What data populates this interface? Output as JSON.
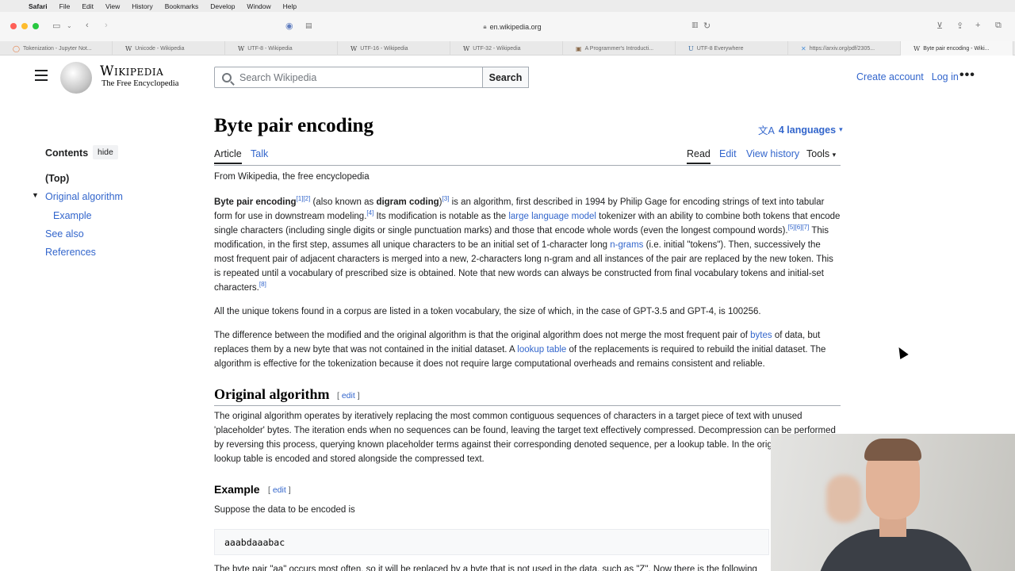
{
  "os_menu": {
    "apple": "",
    "items": [
      "Safari",
      "File",
      "Edit",
      "View",
      "History",
      "Bookmarks",
      "Develop",
      "Window",
      "Help"
    ]
  },
  "browser": {
    "url": "en.wikipedia.org",
    "tabs": [
      {
        "label": "Tokenization - Jupyter Not...",
        "favicon": "◯",
        "active": false
      },
      {
        "label": "Unicode - Wikipedia",
        "favicon": "W",
        "active": false
      },
      {
        "label": "UTF-8 - Wikipedia",
        "favicon": "W",
        "active": false
      },
      {
        "label": "UTF-16 - Wikipedia",
        "favicon": "W",
        "active": false
      },
      {
        "label": "UTF-32 - Wikipedia",
        "favicon": "W",
        "active": false
      },
      {
        "label": "A Programmer's Introducti...",
        "favicon": "▣",
        "active": false
      },
      {
        "label": "UTF-8 Everywhere",
        "favicon": "U",
        "active": false
      },
      {
        "label": "https://arxiv.org/pdf/2305...",
        "favicon": "✕",
        "active": false
      },
      {
        "label": "Byte pair encoding - Wiki...",
        "favicon": "W",
        "active": true
      }
    ]
  },
  "header": {
    "wordmark": "Wikipedia",
    "tagline": "The Free Encyclopedia",
    "search_placeholder": "Search Wikipedia",
    "search_button": "Search",
    "create_account": "Create account",
    "log_in": "Log in",
    "more": "•••"
  },
  "toc": {
    "title": "Contents",
    "hide": "hide",
    "items": [
      "(Top)",
      "Original algorithm",
      "Example",
      "See also",
      "References"
    ]
  },
  "article": {
    "title": "Byte pair encoding",
    "languages": "4 languages",
    "tabs": {
      "article": "Article",
      "talk": "Talk",
      "read": "Read",
      "edit": "Edit",
      "history": "View history",
      "tools": "Tools"
    },
    "from": "From Wikipedia, the free encyclopedia",
    "p1": {
      "term1": "Byte pair encoding",
      "ref12": "[1][2]",
      "t1": " (also known as ",
      "term2": "digram coding",
      "t2": ")",
      "ref3": "[3]",
      "t3": " is an algorithm, first described in 1994 by Philip Gage for encoding strings of text into tabular form for use in downstream modeling.",
      "ref4": "[4]",
      "t4": " Its modification is notable as the ",
      "link_llm": "large language model",
      "t5": " tokenizer with an ability to combine both tokens that encode single characters (including single digits or single punctuation marks) and those that encode whole words (even the longest compound words).",
      "ref5": "[5]",
      "ref67": "[6][7]",
      "t6": " This modification, in the first step, assumes all unique characters to be an initial set of 1-character long ",
      "link_ngrams": "n-grams",
      "t7": " (i.e. initial \"tokens\"). Then, successively the most frequent pair of adjacent characters is merged into a new, 2-characters long n-gram and all instances of the pair are replaced by the new token. This is repeated until a vocabulary of prescribed size is obtained. Note that new words can always be constructed from final vocabulary tokens and initial-set characters.",
      "ref8": "[8]"
    },
    "p2": "All the unique tokens found in a corpus are listed in a token vocabulary, the size of which, in the case of GPT-3.5 and GPT-4, is 100256.",
    "p3": {
      "t1": "The difference between the modified and the original algorithm is that the original algorithm does not merge the most frequent pair of ",
      "link_bytes": "bytes",
      "t2": " of data, but replaces them by a new byte that was not contained in the initial dataset. A ",
      "link_lookup": "lookup table",
      "t3": " of the replacements is required to rebuild the initial dataset. The algorithm is effective for the tokenization because it does not require large computational overheads and remains consistent and reliable."
    },
    "h_original": "Original algorithm",
    "edit_open": "[ ",
    "edit_label": "edit",
    "edit_close": " ]",
    "p4": "The original algorithm operates by iteratively replacing the most common contiguous sequences of characters in a target piece of text with unused 'placeholder' bytes. The iteration ends when no sequences can be found, leaving the target text effectively compressed. Decompression can be performed by reversing this process, querying known placeholder terms against their corresponding denoted sequence, per a lookup table. In the original paper, this lookup table is encoded and stored alongside the compressed text.",
    "h_example": "Example",
    "p5": "Suppose the data to be encoded is",
    "code": "aaabdaaabac",
    "p6": "The byte pair \"aa\" occurs most often, so it will be replaced by a byte that is not used in the data, such as \"Z\". Now there is the following data"
  }
}
